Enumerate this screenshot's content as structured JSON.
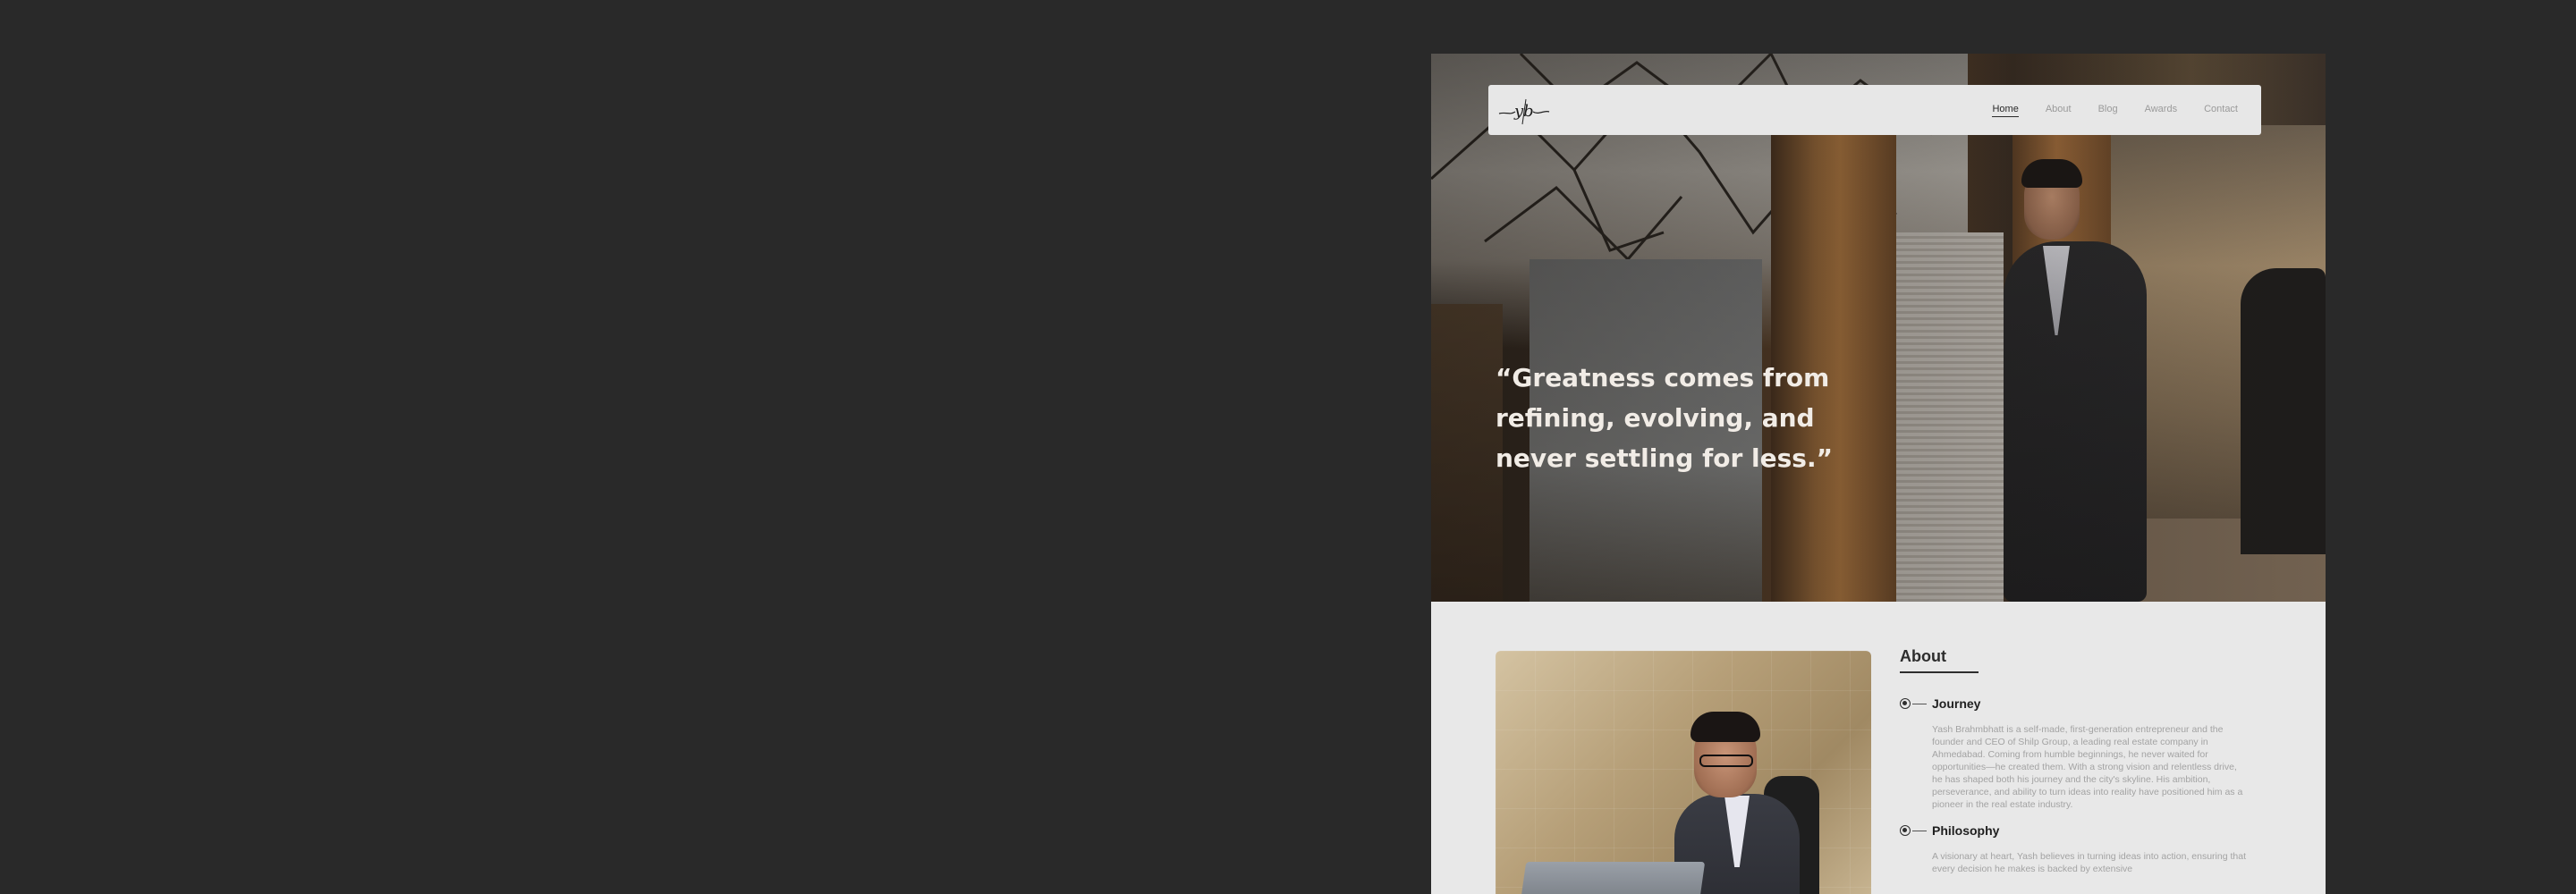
{
  "nav": {
    "logo_text": "yb",
    "links": [
      "Home",
      "About",
      "Blog",
      "Awards",
      "Contact"
    ],
    "active": "Home"
  },
  "hero": {
    "quote": "“Greatness comes from refining, evolving, and never settling for less.”"
  },
  "about": {
    "heading": "About",
    "items": [
      {
        "title": "Journey",
        "text": "Yash Brahmbhatt is a self-made, first-generation entrepreneur and the founder and CEO of Shilp Group, a leading real estate company in Ahmedabad. Coming from humble beginnings, he never waited for opportunities—he created them. With a strong vision and relentless drive, he has shaped both his journey and the city's skyline. His ambition, perseverance, and ability to turn ideas into reality have positioned him as a pioneer in the real estate industry."
      },
      {
        "title": "Philosophy",
        "text": "A visionary at heart, Yash believes in turning ideas into action, ensuring that every decision he makes is backed by extensive"
      }
    ]
  },
  "colors": {
    "page_bg": "#292929",
    "section_bg": "#e8e8e8",
    "nav_bg": "#e7e7e7",
    "text_dark": "#2d2d2d",
    "text_muted": "#a3a3a3",
    "quote_text": "#f1ece6"
  }
}
